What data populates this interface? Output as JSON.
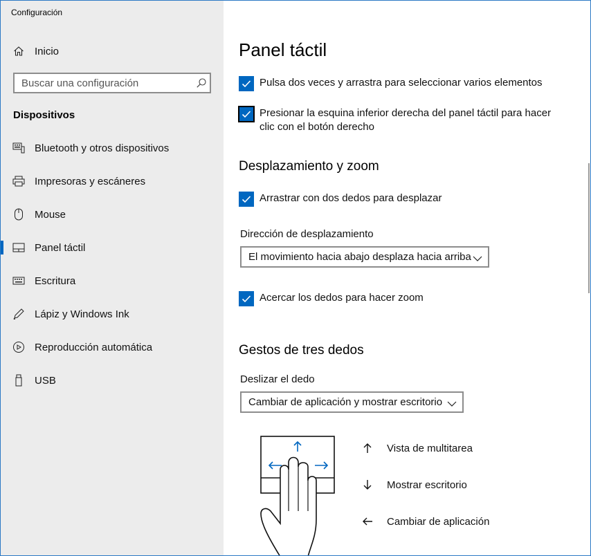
{
  "window": {
    "title": "Configuración"
  },
  "sidebar": {
    "home_label": "Inicio",
    "search_placeholder": "Buscar una configuración",
    "section_title": "Dispositivos",
    "items": [
      {
        "label": "Bluetooth y otros dispositivos",
        "icon": "bluetooth-devices-icon"
      },
      {
        "label": "Impresoras y escáneres",
        "icon": "printer-icon"
      },
      {
        "label": "Mouse",
        "icon": "mouse-icon"
      },
      {
        "label": "Panel táctil",
        "icon": "touchpad-icon",
        "active": true
      },
      {
        "label": "Escritura",
        "icon": "keyboard-icon"
      },
      {
        "label": "Lápiz y Windows Ink",
        "icon": "pen-icon"
      },
      {
        "label": "Reproducción automática",
        "icon": "autoplay-icon"
      },
      {
        "label": "USB",
        "icon": "usb-icon"
      }
    ]
  },
  "main": {
    "page_title": "Panel táctil",
    "checkboxes_top": [
      {
        "label": "Pulsa dos veces y arrastra para seleccionar varios elementos",
        "checked": true
      },
      {
        "label": "Presionar la esquina inferior derecha del panel táctil para hacer clic con el botón derecho",
        "checked": true
      }
    ],
    "scroll_zoom": {
      "title": "Desplazamiento y zoom",
      "drag_label": "Arrastrar con dos dedos para desplazar",
      "direction_label": "Dirección de desplazamiento",
      "direction_value": "El movimiento hacia abajo desplaza hacia arriba",
      "pinch_label": "Acercar los dedos para hacer zoom"
    },
    "three_finger": {
      "title": "Gestos de tres dedos",
      "swipe_label": "Deslizar el dedo",
      "swipe_value": "Cambiar de aplicación y mostrar escritorio",
      "gestures": [
        {
          "label": "Vista de multitarea",
          "icon": "arrow-up-icon"
        },
        {
          "label": "Mostrar escritorio",
          "icon": "arrow-down-icon"
        },
        {
          "label": "Cambiar de aplicación",
          "icon": "arrow-left-icon"
        }
      ]
    }
  },
  "colors": {
    "accent": "#0067c0",
    "sidebar_bg": "#ececec",
    "window_border": "#2b78c5"
  }
}
